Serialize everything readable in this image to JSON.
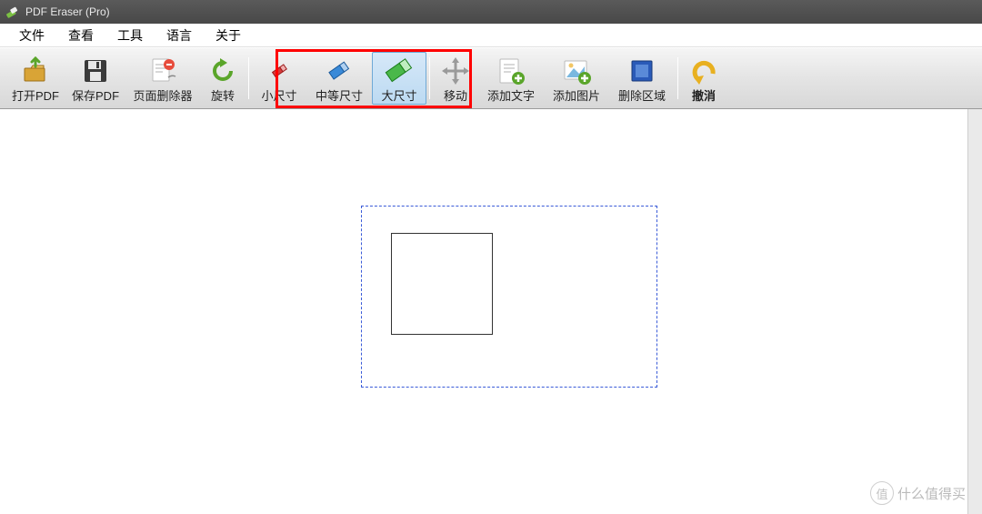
{
  "title": "PDF Eraser (Pro)",
  "menubar": {
    "file": "文件",
    "view": "查看",
    "tools": "工具",
    "language": "语言",
    "about": "关于"
  },
  "toolbar": {
    "open": "打开PDF",
    "save": "保存PDF",
    "page_deleter": "页面删除器",
    "rotate": "旋转",
    "small_size": "小尺寸",
    "medium_size": "中等尺寸",
    "large_size": "大尺寸",
    "move": "移动",
    "add_text": "添加文字",
    "add_image": "添加图片",
    "delete_area": "删除区域",
    "undo": "撤消"
  },
  "watermark": {
    "badge": "值",
    "text": "什么值得买"
  }
}
